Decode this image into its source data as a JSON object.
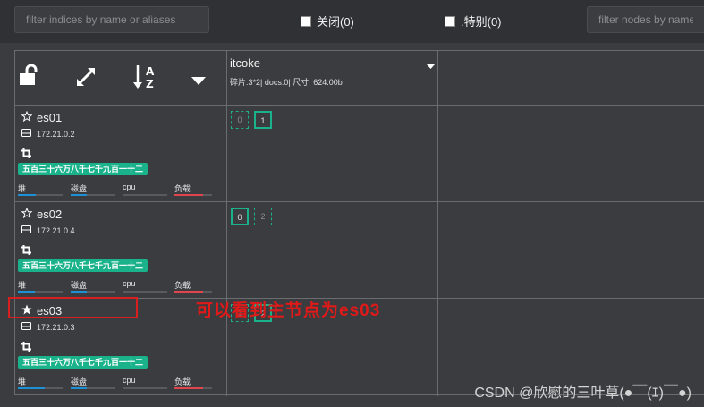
{
  "filters": {
    "indices_placeholder": "filter indices by name or aliases",
    "nodes_placeholder": "filter nodes by name"
  },
  "checkboxes": [
    {
      "label": "关闭(0)",
      "checked": false
    },
    {
      "label": ".特别(0)",
      "checked": false
    }
  ],
  "header_icons": [
    "unlock-icon",
    "expand-icon",
    "sort-alpha-down-icon",
    "caret-down-icon"
  ],
  "index": {
    "name": "itcoke",
    "stats": "碎片:3*2| docs:0| 尺寸: 624.00b"
  },
  "nodes": [
    {
      "name": "es01",
      "master": false,
      "ip": "172.21.0.2",
      "tag": "五百三十六万八千七千九百一十二",
      "metrics": [
        {
          "label": "堆",
          "value": 0.4,
          "color": "#1e90d6"
        },
        {
          "label": "磁盘",
          "value": 0.35,
          "color": "#1e90d6"
        },
        {
          "label": "cpu",
          "value": 0.02,
          "color": "#1e90d6"
        },
        {
          "label": "负载",
          "value": 0.75,
          "color": "#e0444c"
        }
      ],
      "shards": [
        {
          "num": "0",
          "type": "replica"
        },
        {
          "num": "1",
          "type": "primary"
        }
      ]
    },
    {
      "name": "es02",
      "master": false,
      "ip": "172.21.0.4",
      "tag": "五百三十六万八千七千九百一十二",
      "metrics": [
        {
          "label": "堆",
          "value": 0.38,
          "color": "#1e90d6"
        },
        {
          "label": "磁盘",
          "value": 0.35,
          "color": "#1e90d6"
        },
        {
          "label": "cpu",
          "value": 0.02,
          "color": "#1e90d6"
        },
        {
          "label": "负载",
          "value": 0.75,
          "color": "#e0444c"
        }
      ],
      "shards": [
        {
          "num": "0",
          "type": "primary"
        },
        {
          "num": "2",
          "type": "replica"
        }
      ]
    },
    {
      "name": "es03",
      "master": true,
      "ip": "172.21.0.3",
      "tag": "五百三十六万八千七千九百一十二",
      "metrics": [
        {
          "label": "堆",
          "value": 0.6,
          "color": "#1e90d6"
        },
        {
          "label": "磁盘",
          "value": 0.35,
          "color": "#1e90d6"
        },
        {
          "label": "cpu",
          "value": 0.02,
          "color": "#1e90d6"
        },
        {
          "label": "负载",
          "value": 0.75,
          "color": "#e0444c"
        }
      ],
      "shards": [
        {
          "num": "1",
          "type": "replica"
        },
        {
          "num": "2",
          "type": "primary"
        }
      ]
    }
  ],
  "annotation": "可以看到主节点为es03",
  "watermark": "CSDN @欣慰的三叶草(●￣(ｴ)￣●)"
}
